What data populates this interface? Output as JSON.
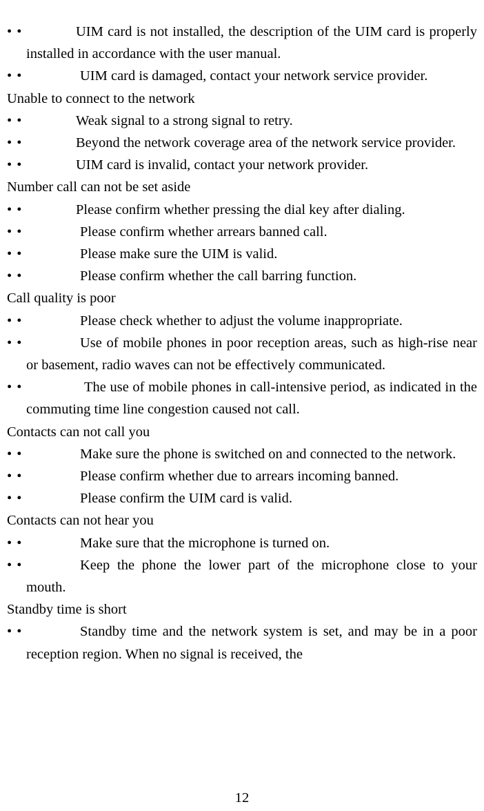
{
  "document": {
    "page_number": "12",
    "bullet_glyph": "•",
    "text_color": "#000000",
    "background_color": "#ffffff",
    "blocks": [
      {
        "kind": "bullet",
        "indent": "w4",
        "text": "UIM card is not installed, the description of the UIM card is properly installed in accordance with the user manual."
      },
      {
        "kind": "bullet",
        "indent": "w5",
        "text": "UIM card is damaged, contact your network service provider."
      },
      {
        "kind": "heading",
        "text": "Unable to connect to the network"
      },
      {
        "kind": "bullet",
        "indent": "w4",
        "text": "Weak signal to a strong signal to retry."
      },
      {
        "kind": "bullet",
        "indent": "w4",
        "text": "Beyond the network coverage area of the network service provider."
      },
      {
        "kind": "bullet",
        "indent": "w4",
        "text": "UIM card is invalid, contact your network provider."
      },
      {
        "kind": "heading",
        "text": "Number call can not be set aside"
      },
      {
        "kind": "bullet",
        "indent": "w4",
        "text": "Please confirm whether pressing the dial key after dialing."
      },
      {
        "kind": "bullet",
        "indent": "w5",
        "text": "Please confirm whether arrears banned call."
      },
      {
        "kind": "bullet",
        "indent": "w5",
        "text": "Please make sure the UIM is valid."
      },
      {
        "kind": "bullet",
        "indent": "w5",
        "text": "Please confirm whether the call barring function."
      },
      {
        "kind": "heading",
        "text": "Call quality is poor"
      },
      {
        "kind": "bullet",
        "indent": "w5",
        "text": "Please check whether to adjust the volume inappropriate."
      },
      {
        "kind": "bullet",
        "indent": "w5",
        "text": "Use of mobile phones in poor reception areas, such as high-rise near or basement, radio waves can not be effectively communicated."
      },
      {
        "kind": "bullet",
        "indent": "w6",
        "text": "The use of mobile phones in call-intensive period, as indicated in the commuting time line congestion caused not call."
      },
      {
        "kind": "heading",
        "text": "Contacts can not call you"
      },
      {
        "kind": "bullet",
        "indent": "w5",
        "text": "Make sure the phone is switched on and connected to the network."
      },
      {
        "kind": "bullet",
        "indent": "w5",
        "text": "Please confirm whether due to arrears incoming banned."
      },
      {
        "kind": "bullet",
        "indent": "w5",
        "text": "Please confirm the UIM card is valid."
      },
      {
        "kind": "heading",
        "text": "Contacts can not hear you"
      },
      {
        "kind": "bullet",
        "indent": "w5",
        "text": "Make sure that the microphone is turned on."
      },
      {
        "kind": "bullet",
        "indent": "w5",
        "text": "Keep the phone the lower part of the microphone close to your mouth."
      },
      {
        "kind": "heading",
        "text": "Standby time is short"
      },
      {
        "kind": "bullet",
        "indent": "w5",
        "text": "Standby time and the network system is set, and may be in a poor reception region. When no signal is received, the"
      }
    ]
  }
}
